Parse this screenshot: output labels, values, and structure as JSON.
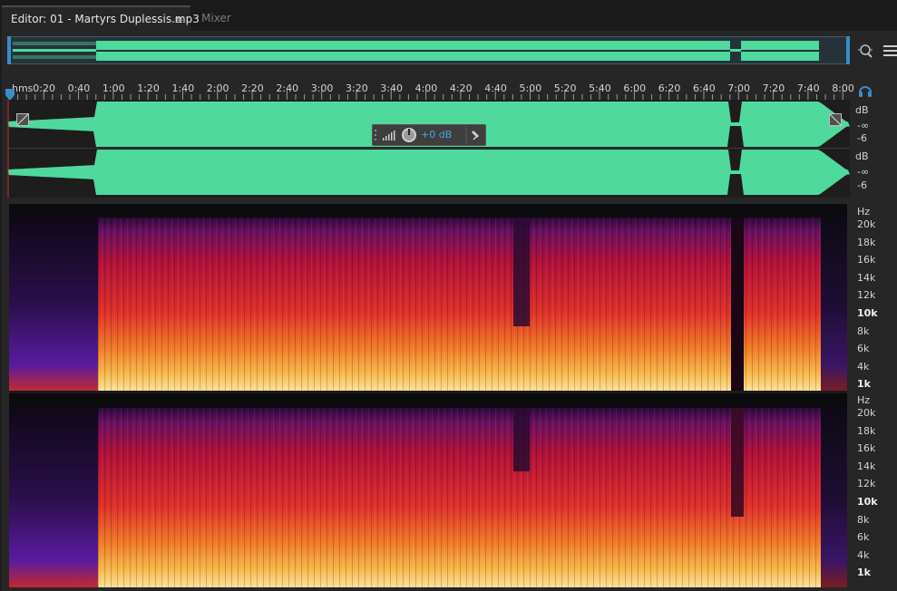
{
  "tabs": {
    "editor_label": "Editor: 01 - Martyrs Duplessis.mp3",
    "mixer_label": "Mixer"
  },
  "timeline": {
    "unit_label": "hms",
    "ticks": [
      "0:20",
      "0:40",
      "1:00",
      "1:20",
      "1:40",
      "2:00",
      "2:20",
      "2:40",
      "3:00",
      "3:20",
      "3:40",
      "4:00",
      "4:20",
      "4:40",
      "5:00",
      "5:20",
      "5:40",
      "6:00",
      "6:20",
      "6:40",
      "7:00",
      "7:20",
      "7:40",
      "8:00"
    ]
  },
  "waveform": {
    "db_unit": "dB",
    "db_values": [
      "-∞",
      "-6"
    ],
    "color": "#4fd99c"
  },
  "hud": {
    "volume_value": "+0 dB"
  },
  "spectrogram": {
    "unit": "Hz",
    "freq_labels": [
      "20k",
      "18k",
      "16k",
      "14k",
      "12k",
      "10k",
      "8k",
      "6k",
      "4k",
      "1k"
    ]
  },
  "icons": {
    "zoom": "zoom-icon",
    "menu": "menu-lines-icon",
    "headphones": "headphones-icon",
    "pin": "pin-icon"
  }
}
